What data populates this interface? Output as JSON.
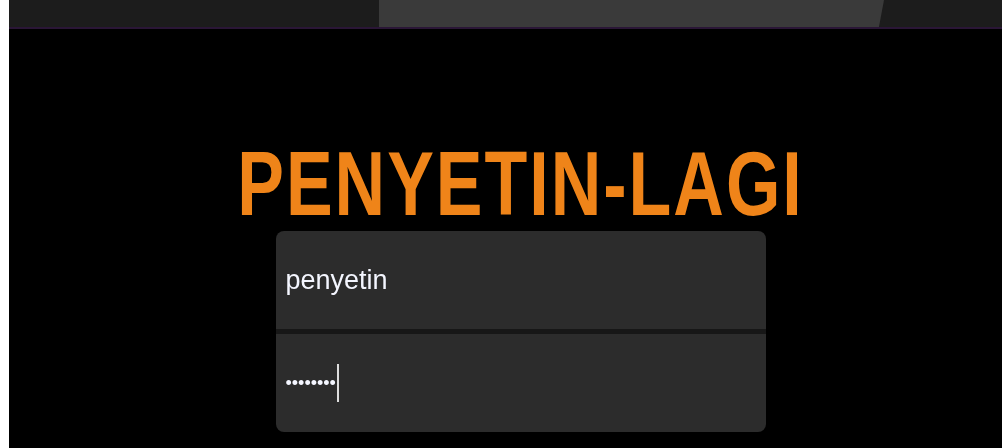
{
  "title": "PENYETIN-LAGI",
  "fields": [
    {
      "kind": "text",
      "value": "penyetin",
      "focused": false
    },
    {
      "kind": "password",
      "value": "••••••••",
      "focused": true
    }
  ]
}
